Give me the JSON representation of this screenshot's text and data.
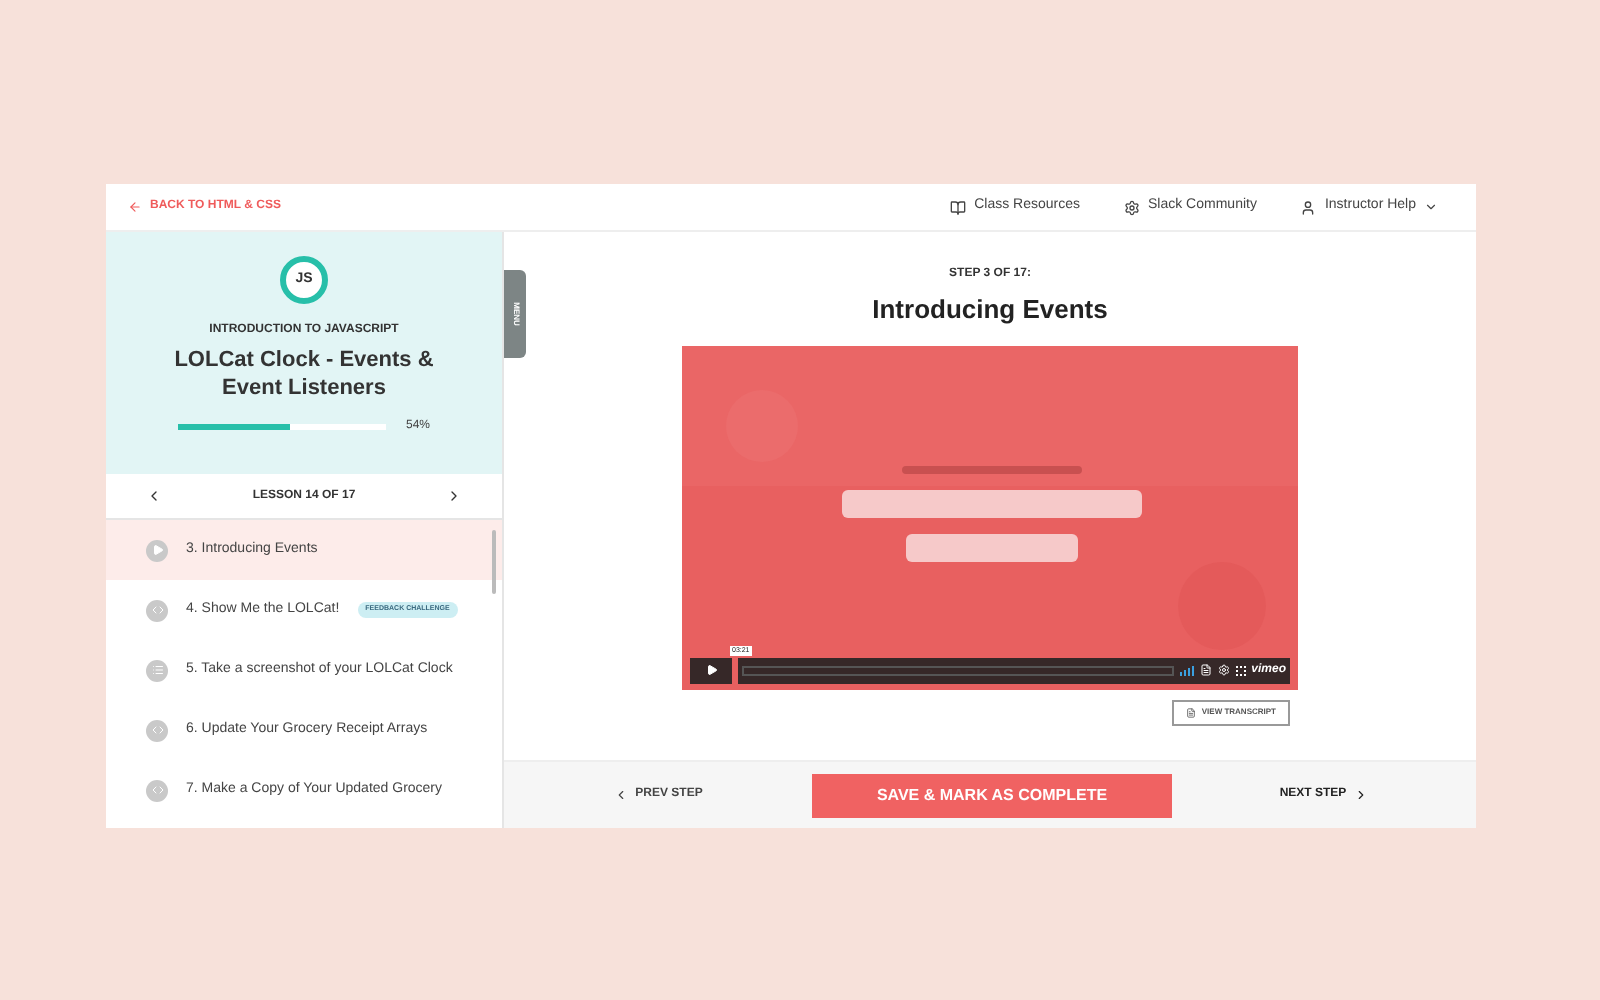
{
  "header": {
    "back_link": "BACK TO HTML & CSS",
    "links": [
      {
        "kind": "resources",
        "label": "Class Resources"
      },
      {
        "kind": "community",
        "label": "Slack Community"
      },
      {
        "kind": "help",
        "label": "Instructor Help"
      }
    ]
  },
  "sidebar": {
    "badge": "JS",
    "course": "INTRODUCTION TO JAVASCRIPT",
    "title": "LOLCat Clock - Events & Event Listeners",
    "progress": {
      "level": 0.54,
      "reading": "54%"
    },
    "lesson_nav": "LESSON 14 OF 17",
    "menu_tab": "MENU",
    "steps": [
      {
        "kind": "video",
        "label": "3. Introducing Events",
        "selected": true
      },
      {
        "kind": "code",
        "label": "4. Show Me the LOLCat!",
        "tag": "FEEDBACK CHALLENGE",
        "selected": false
      },
      {
        "kind": "list",
        "label": "5. Take a screenshot of your LOLCat Clock",
        "selected": false
      },
      {
        "kind": "code",
        "label": "6. Update Your Grocery Receipt Arrays",
        "selected": false
      },
      {
        "kind": "code",
        "label": "7. Make a Copy of Your Updated Grocery",
        "selected": false
      }
    ]
  },
  "content": {
    "step_label": "STEP 3 OF 17:",
    "title": "Introducing Events",
    "video": {
      "kind": "picture",
      "time": "03:21",
      "brand": "vimeo"
    },
    "transcript_button": "VIEW TRANSCRIPT"
  },
  "footer": {
    "prev": "PREV STEP",
    "primary": "SAVE & MARK AS COMPLETE",
    "next": "NEXT STEP"
  }
}
